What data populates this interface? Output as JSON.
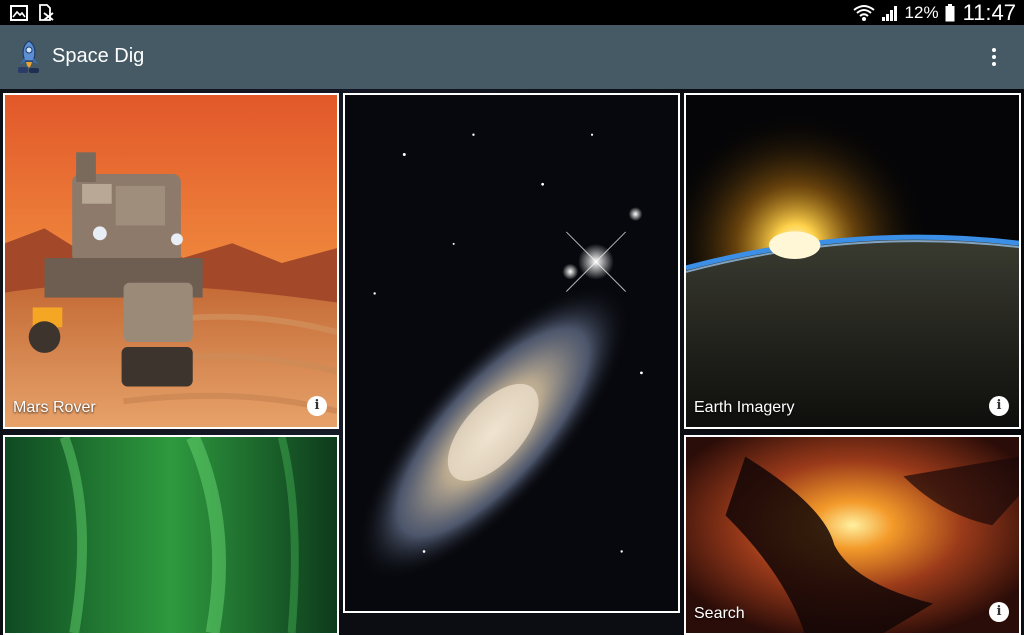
{
  "status_bar": {
    "left_icons": [
      "image-notification-icon",
      "sim-card-error-icon"
    ],
    "battery_percent": "12%",
    "time": "11:47"
  },
  "app_bar": {
    "title": "Space Dig",
    "logo": "rocket-logo-icon",
    "menu_icon": "more-vert-icon"
  },
  "tiles": {
    "mars_rover": {
      "label": "Mars Rover"
    },
    "earth_imagery": {
      "label": "Earth Imagery"
    },
    "search": {
      "label": "Search"
    },
    "galaxy": {
      "label": ""
    },
    "aurora": {
      "label": ""
    }
  },
  "colors": {
    "app_bar": "#455a64",
    "status_bar": "#000000",
    "tile_border": "#ffffff"
  }
}
